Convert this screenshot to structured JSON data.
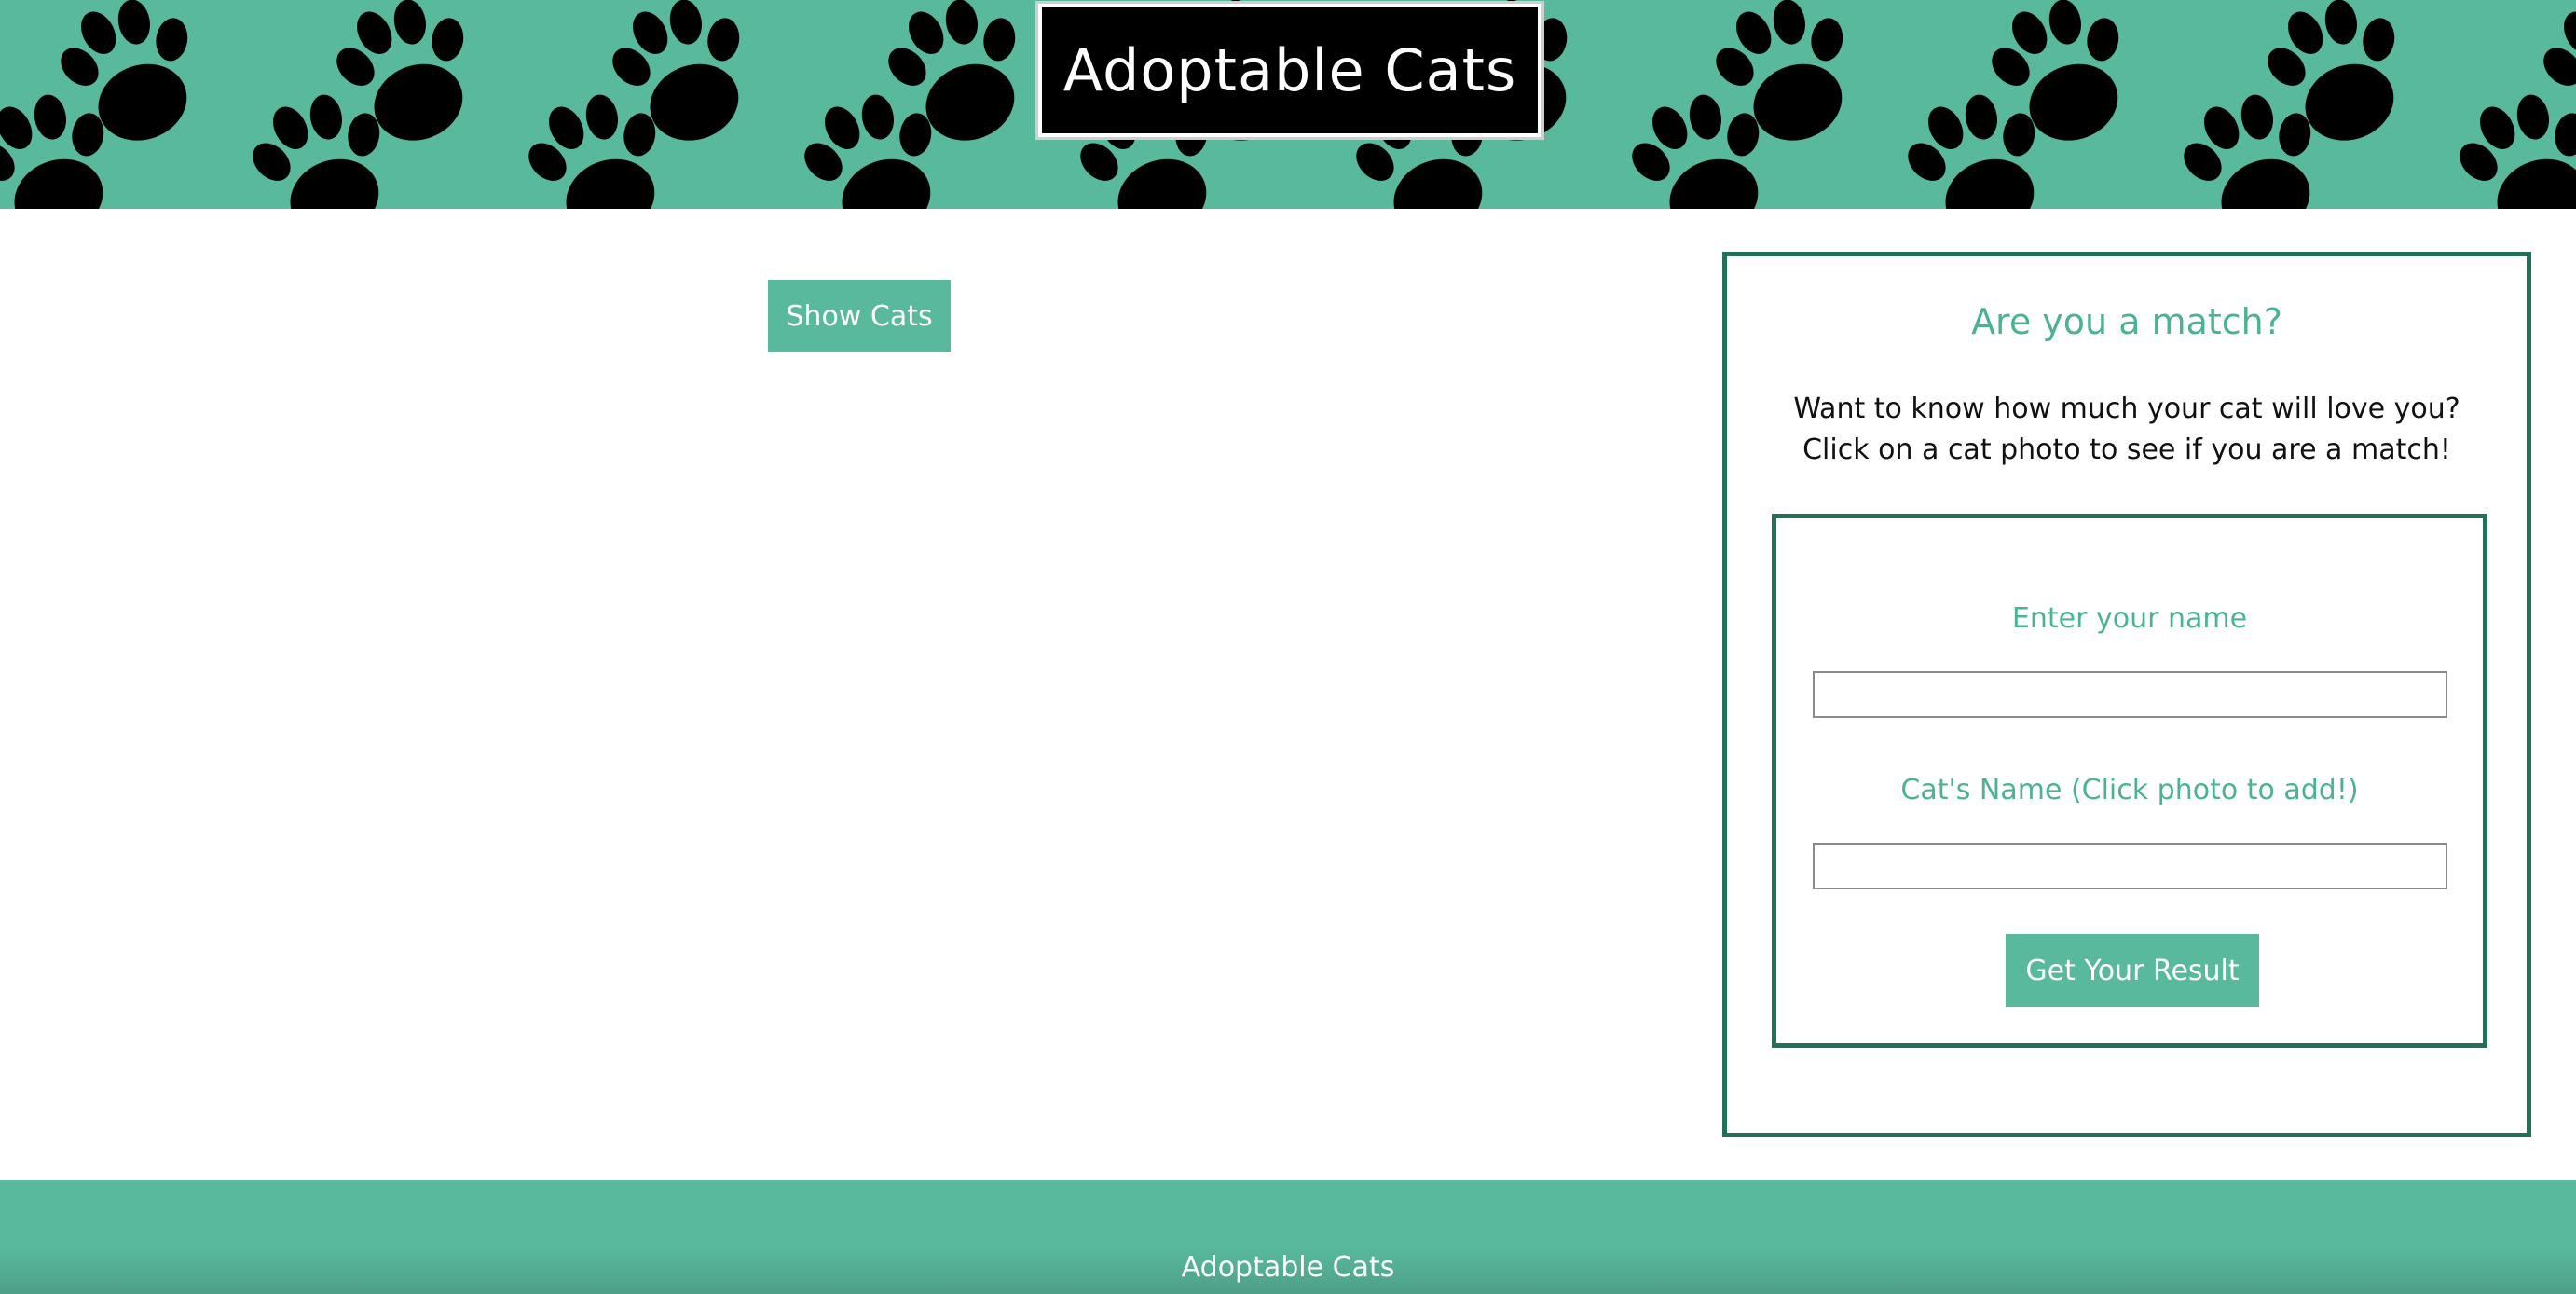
{
  "header": {
    "title": "Adoptable Cats",
    "pattern_icon": "paw-print-icon",
    "background_color": "#58b99c"
  },
  "main": {
    "show_cats_label": "Show Cats"
  },
  "match_panel": {
    "title": "Are you a match?",
    "description_line1": "Want to know how much your cat will love you?",
    "description_line2": "Click on a cat photo to see if you are a match!",
    "form": {
      "name_label": "Enter your name",
      "name_value": "",
      "cat_label": "Cat's Name (Click photo to add!)",
      "cat_value": "",
      "submit_label": "Get Your Result"
    },
    "border_color": "#22705a",
    "accent_color": "#4db295"
  },
  "footer": {
    "text": "Adoptable Cats"
  }
}
